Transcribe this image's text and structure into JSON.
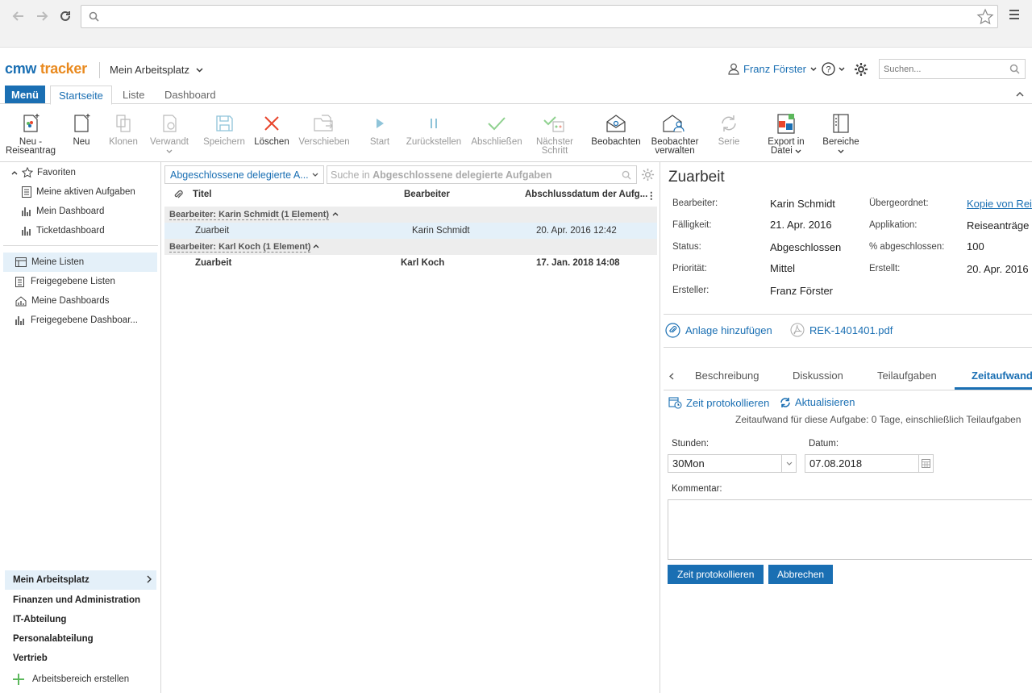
{
  "browser": {
    "address_value": ""
  },
  "header": {
    "logo_cmw": "cmw",
    "logo_tracker": "tracker",
    "workspace_title": "Mein Arbeitsplatz",
    "user_name": "Franz Förster",
    "search_placeholder": "Suchen..."
  },
  "tabs": {
    "menu": "Menü",
    "items": [
      "Startseite",
      "Liste",
      "Dashboard"
    ]
  },
  "toolbar": {
    "new_trip": [
      "Neu -",
      "Reiseantrag"
    ],
    "new": "Neu",
    "clone": "Klonen",
    "manage": "Verwandt",
    "save": "Speichern",
    "delete": "Löschen",
    "move": "Verschieben",
    "start": "Start",
    "reset": "Zurückstellen",
    "complete": "Abschließen",
    "next_step": [
      "Nächster",
      "Schritt"
    ],
    "watch": "Beobachten",
    "manage_watchers": [
      "Beobachter",
      "verwalten"
    ],
    "series": "Serie",
    "export": [
      "Export in",
      "Datei"
    ],
    "areas": "Bereiche"
  },
  "leftnav": {
    "favorites": "Favoriten",
    "fav_items": [
      "Meine aktiven Aufgaben",
      "Mein Dashboard",
      "Ticketdashboard"
    ],
    "list_items": [
      "Meine Listen",
      "Freigegebene Listen",
      "Meine Dashboards",
      "Freigegebene Dashboar..."
    ],
    "workspaces": [
      "Mein Arbeitsplatz",
      "Finanzen und Administration",
      "IT-Abteilung",
      "Personalabteilung",
      "Vertrieb"
    ],
    "create_workspace": "Arbeitsbereich erstellen"
  },
  "list": {
    "view_name": "Abgeschlossene delegierte A...",
    "search_prefix": "Suche in",
    "search_target": "Abgeschlossene delegierte Aufgaben",
    "columns": [
      "Titel",
      "Bearbeiter",
      "Abschlussdatum der Aufg...",
      "⋮"
    ],
    "groups": [
      {
        "label": "Bearbeiter: Karin Schmidt (1 Element)",
        "rows": [
          {
            "title": "Zuarbeit",
            "assignee": "Karin Schmidt",
            "date": "20. Apr. 2016 12:42"
          }
        ]
      },
      {
        "label": "Bearbeiter: Karl Koch (1 Element)",
        "rows": [
          {
            "title": "Zuarbeit",
            "assignee": "Karl Koch",
            "date": "17. Jan. 2018 14:08"
          }
        ]
      }
    ]
  },
  "detail": {
    "title": "Zuarbeit",
    "fields": {
      "assignee_label": "Bearbeiter:",
      "assignee": "Karin Schmidt",
      "due_label": "Fälligkeit:",
      "due": "21. Apr. 2016",
      "status_label": "Status:",
      "status": "Abgeschlossen",
      "priority_label": "Priorität:",
      "priority": "Mittel",
      "creator_label": "Ersteller:",
      "creator": "Franz Förster",
      "parent_label": "Übergeordnet:",
      "parent": "Kopie von Rei",
      "app_label": "Applikation:",
      "app": "Reiseanträge",
      "pct_label": "% abgeschlossen:",
      "pct": "100",
      "created_label": "Erstellt:",
      "created": "20. Apr. 2016"
    },
    "attach_add": "Anlage hinzufügen",
    "attachment": "REK-1401401.pdf",
    "tabs": [
      "Beschreibung",
      "Diskussion",
      "Teilaufgaben",
      "Zeitaufwand"
    ],
    "log_time": "Zeit protokollieren",
    "refresh": "Aktualisieren",
    "effort_text": "Zeitaufwand für diese Aufgabe: 0 Tage, einschließlich Teilaufgaben",
    "hours_label": "Stunden:",
    "hours_value": "30Mon",
    "date_label": "Datum:",
    "date_value": "07.08.2018",
    "comment_label": "Kommentar:",
    "btn_log": "Zeit protokollieren",
    "btn_cancel": "Abbrechen"
  },
  "colors": {
    "accent": "#1a6fb3",
    "logo_orange": "#e98a1f",
    "highlight": "#e4f0f9",
    "delete_red": "#e8452c",
    "complete_green": "#5cb85c"
  }
}
